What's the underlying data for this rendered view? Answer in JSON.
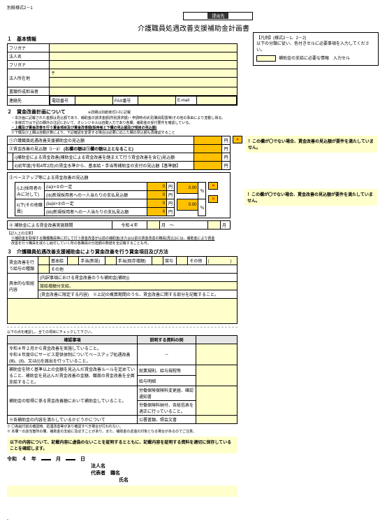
{
  "form_code": "別紙様式2－1",
  "submit_to_label": "提出先",
  "title": "介護職員処遇改善支援補助金計画書",
  "legend": {
    "heading": "【凡例】(様式2－1、2－2)",
    "line1": "以下の分類に従い、色付きセルに必要事項を入力してください。",
    "swatch_label": "補助金の支給に必要な情報　入力セル"
  },
  "sec1": {
    "heading": "１　基本情報",
    "rows": {
      "furigana1": "フリガナ",
      "houjinmei": "法人名",
      "furigana2": "フリガナ",
      "houjinaddr": "法人所在地",
      "tel_label": "〒",
      "tantou": "書類作成担当者",
      "renraku": "連絡先",
      "tel": "電話番号",
      "fax": "FAX番号",
      "email": "E-mail"
    }
  },
  "sec2": {
    "heading": "２　賃金改善計画について",
    "top_note": "※詳細は別紙様式2-2に記載",
    "note1": "・本計画に記載された金額は見込額であり、補助金の請求金額(所別請求額)・申請時点状況(職員配置等)その他の事由により変動し得る。",
    "note2": "・本様式では下記の欄外の注記において、オレンジセルは自動入力であり各欄、補助金の受付要件を確認している。",
    "note3_bold": "・上欄及び賃金改善を行う賃金項目及び賃金改善額(採用者と下欄の見込額及び項目の見込額)",
    "note3_tail": "※下欄及び上欄は自動計算により、下記確認を変更する場合は必要に応じた欄の見込額も再確認すること"
  },
  "block1": {
    "row1_label": "①介護職員処遇改善支援補助金の見込額",
    "row2_label": "②賃金改善の見込額（ⅰ－ⅱ）",
    "row2_note": "(右欄の額は①欄の額以上となること)",
    "row_i": "ⅰ)補助金による賃金改善(補助金による賃金改善を踏まえて行う賃金改善を含む)見込額",
    "row_ii": "ⅱ)初年度(令和4年2月)の賃金水準から、基本給・手当等補助金の支付の見込額【基準額】",
    "yen": "円",
    "callout1": "！この欄が〇でない場合、賃金改善の見込額が要件を満たしていません。"
  },
  "block2": {
    "heading": "③ベースアップ等による賃金改善の見込額",
    "rowA_label": "ⅰ)上(採用者のみに対して)",
    "rowA_sub1": "(ⅰa)ⅰ×②の一定",
    "rowA_sub2": "(ⅰb)新規採用者への一人当たりの支払見込額",
    "rowB_label": "ⅱ)下(その他職員)",
    "rowB_sub1": "(ⅱa)ⅱ×②の一定",
    "rowB_sub2": "(ⅱb)新規採用者への一人当たりの支払見込額",
    "pct": "0.00",
    "perc": "％",
    "yen": "円",
    "callout2": "！この欄が〇でない場合、賃金改善の見込額が要件を満たしていません。"
  },
  "block3": {
    "label": "④ 補助金による賃金改善実施期間",
    "period": "令和４年",
    "month": "月　～"
  },
  "sec2_bottom": {
    "note_head": "【記入上の注意】",
    "note_line": "※補助金を取得する職種職員等に対して行う賃金改善が以前の補助金(または以前の賃金改善の職員(見込))には、補助金により賃金",
    "note_line2": "改善を行う職員を減らし給付していく所の各職員の分担額の数値を全記載することも可。"
  },
  "sec3": {
    "heading": "３　介護職員処遇改善支援補助金により賃金改善を行う賃金項目及び方法",
    "table": {
      "col_a": "賃金改善を行う給与の種類",
      "col_b": "基本給",
      "col_c": "手当(新設)",
      "col_d": "手当(既存増額)",
      "col_e": "賞与",
      "col_f": "その他",
      "col_f_paren": "(　　　　　)",
      "subrow_label": "その他",
      "detail1": "(内訳事項における賃金改善のうち補助金(補助))",
      "detail_line2": "賞給増額分支給、",
      "detail_line3": "(賃金改善に限定する内容)　※上記の概算期間のうち、賃金改善に関する部分を記載すること。",
      "left_label": "具体的な取組内容"
    }
  },
  "confirm": {
    "lead": "以下の点を確認し、全ての項目にチェックして下さい。",
    "th1": "確認事項",
    "th2": "説明する資料の例",
    "th3": "",
    "rows": [
      {
        "text": "令和４年２月から賃金改善を実施していること。\n令和４年度中にサービス提供体制についてベースアップ処遇改善(Ⅲ)、(Ⅱ)、又は(Ⅰ)を届出を行っていること。",
        "col2": "－",
        "col3": ""
      },
      {
        "text": "補助金を除く基準以上の金額を見込んだ賃金改善ルールを定めていること、補助金を見込んだ賃金改善の金額、職員の賃金改善を全面支給すること。",
        "col2": "就業規則、給与規程等",
        "col3": ""
      },
      {
        "text": "",
        "col2": "給与明細",
        "col3": ""
      },
      {
        "text": "補助金の取得に係る賃金改善額において補助金していること。",
        "col2": "労働保険保険料変更届、確認通知書",
        "col3": ""
      },
      {
        "text": "労働保険料納付、各総括表を適正に行っていること。",
        "col2": "",
        "col3": ""
      },
      {
        "text": "",
        "col2": "公署書類、照会文書",
        "col3": ""
      }
    ],
    "foot_note1": "※ 〇各給付前の確認時、処遇改善等があり確認すべき場合が行われない。",
    "foot_note2": "※ 本欄一の該当箇所の欄、補助金の支給に及ぼすことがあり、また、補助金の返還の対象となる場合があるのでご注意。",
    "statement": "以下の内容について、記載内容に虚偽のないことを証明するとともに、記載内容を証明する資料を適切に保存していることを確認します。",
    "date_label": "令和　４　年　　　月　　　日",
    "corp_label": "法人名",
    "rep_label": "代表者",
    "jobtitle": "職名",
    "name": "氏名"
  }
}
